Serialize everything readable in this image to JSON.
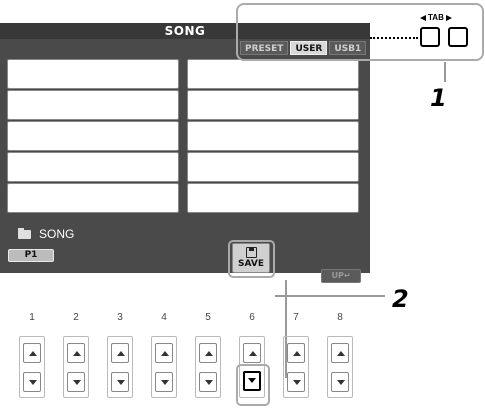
{
  "screen": {
    "title": "SONG",
    "tabs": [
      {
        "label": "PRESET",
        "active": false
      },
      {
        "label": "USER",
        "active": true
      },
      {
        "label": "USB1",
        "active": false
      }
    ],
    "file_slots": 10,
    "path": {
      "icon": "folder-icon",
      "label": "SONG"
    },
    "page_button": "P1",
    "save_button": {
      "icon": "disk-icon",
      "label": "SAVE"
    },
    "up_button": "UP"
  },
  "callouts": {
    "tab_legend": "TAB",
    "step_1": "1",
    "step_2": "2"
  },
  "button_row": {
    "columns": [
      "1",
      "2",
      "3",
      "4",
      "5",
      "6",
      "7",
      "8"
    ],
    "highlighted": {
      "column": "6",
      "button": "down"
    }
  },
  "colors": {
    "screen_bg": "#4a4a4a",
    "title_bar": "#383838",
    "callout_border": "#aaaaaa"
  }
}
